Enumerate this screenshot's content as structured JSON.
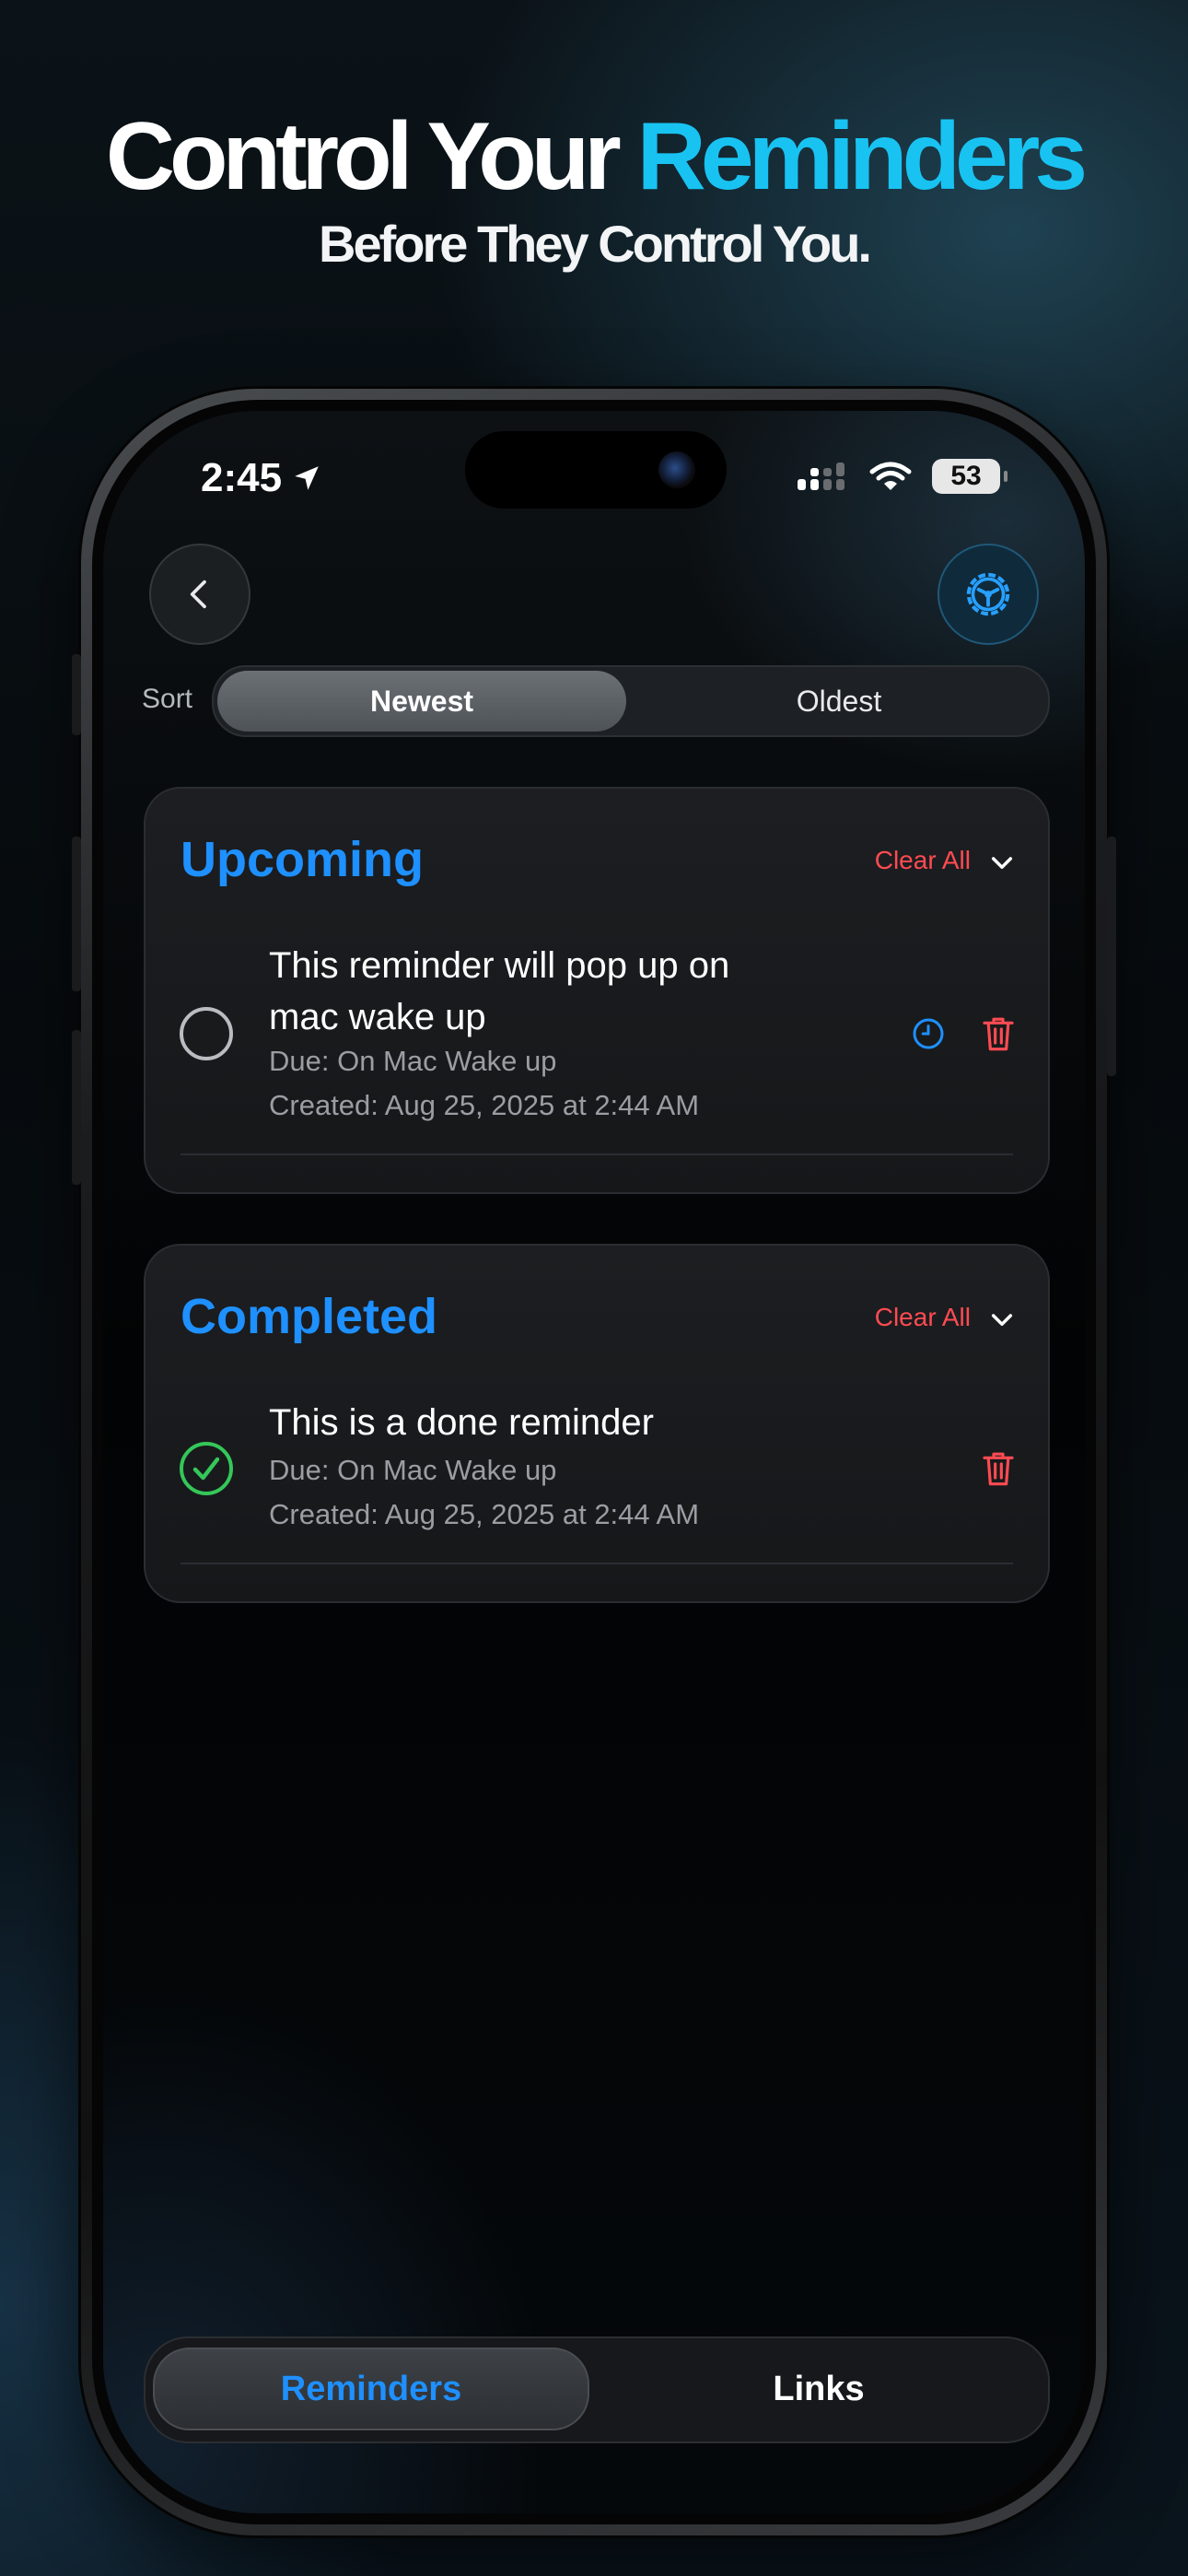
{
  "marketing": {
    "headline_prefix": "Control Your ",
    "headline_accent": "Reminders",
    "subline": "Before They Control You."
  },
  "status_bar": {
    "time": "2:45",
    "battery": "53"
  },
  "sort": {
    "label": "Sort",
    "options": [
      "Newest",
      "Oldest"
    ],
    "selected": "Newest"
  },
  "sections": [
    {
      "title": "Upcoming",
      "clear_all": "Clear All",
      "items": [
        {
          "title": "This reminder will pop up on mac wake up",
          "due": "Due: On Mac Wake up",
          "created": "Created: Aug 25, 2025 at 2:44 AM",
          "completed": false
        }
      ]
    },
    {
      "title": "Completed",
      "clear_all": "Clear All",
      "items": [
        {
          "title": "This is a done reminder",
          "due": "Due: On Mac Wake up",
          "created": "Created: Aug 25, 2025 at 2:44 AM",
          "completed": true
        }
      ]
    }
  ],
  "tabs": [
    {
      "label": "Reminders",
      "active": true
    },
    {
      "label": "Links",
      "active": false
    }
  ],
  "colors": {
    "accent_blue": "#1e90ff",
    "headline_cyan": "#18c3f2",
    "danger_red": "#ff4b52",
    "success_green": "#34c759"
  },
  "icons": {
    "back": "chevron-left-icon",
    "settings": "gear-icon",
    "reschedule": "clock-icon",
    "delete": "trash-icon",
    "collapse": "chevron-down-icon"
  }
}
